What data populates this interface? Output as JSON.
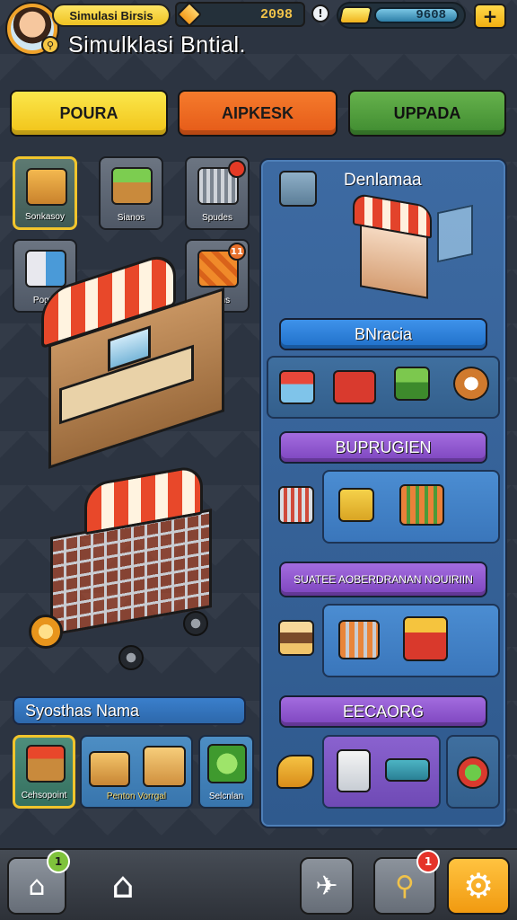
{
  "player": {
    "name": "Simulasi Birsis",
    "coins": "2098",
    "gems": "9608"
  },
  "header": {
    "subtitle": "Simulklasi Bntial."
  },
  "tabs": [
    {
      "label": "POURA",
      "color": "#f1c318"
    },
    {
      "label": "AIPKESK",
      "color": "#e55a18"
    },
    {
      "label": "UPPADA",
      "color": "#3f8b30"
    }
  ],
  "left_tiles": [
    {
      "label": "Sonkasoy",
      "icon": "box-icon",
      "selected": true
    },
    {
      "label": "Sianos",
      "icon": "produce-crate-icon",
      "selected": false
    },
    {
      "label": "Spudes",
      "icon": "cart-icon",
      "selected": false,
      "badge": ""
    },
    {
      "label": "Pogta",
      "icon": "vending-machine-icon",
      "selected": false
    },
    {
      "label": "Brains",
      "icon": "coupon-icon",
      "selected": false,
      "badge": "11"
    }
  ],
  "panel": {
    "title": "Denlamaa",
    "sections": [
      {
        "label": "BNracia",
        "color": "blue"
      },
      {
        "label": "BUPRUGIEN",
        "color": "purple"
      },
      {
        "label_line1": "SUATEE AOBERD",
        "label_line2": "RANAN NOUIRIIN",
        "color": "purple"
      },
      {
        "label": "EECAORG",
        "color": "purple"
      }
    ]
  },
  "strip": {
    "label": "Syosthas Nama",
    "tiles": [
      {
        "label": "Cehsopoint",
        "icon": "storefront-icon",
        "selected": true
      },
      {
        "label": "Penton Vorrgal",
        "icon": "boxes-icon",
        "selected": false
      },
      {
        "label": "Selcnlan",
        "icon": "plant-icon",
        "selected": false
      }
    ]
  },
  "bottom_nav": {
    "home_badge": "1",
    "alerts_badge": "1"
  },
  "colors": {
    "accent_gold": "#f1c52c",
    "panel_blue": "#3d6aa2",
    "section_purple": "#7d45be",
    "section_blue": "#1f6fc8"
  }
}
